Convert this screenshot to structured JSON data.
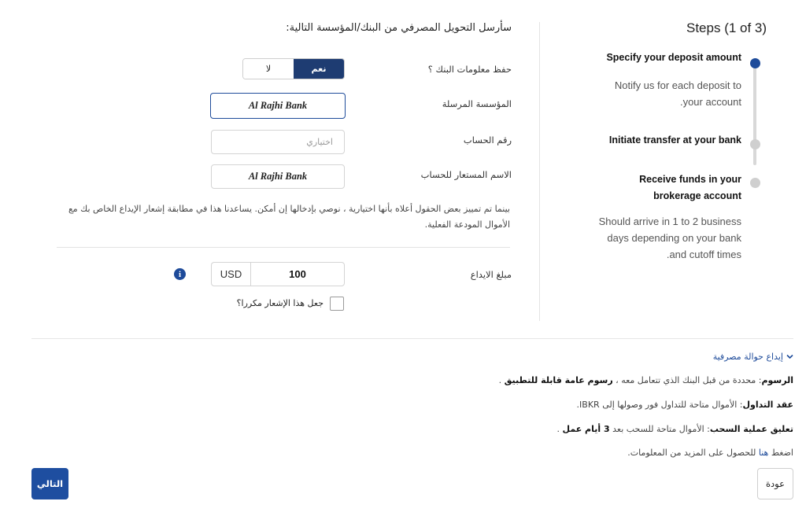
{
  "steps": {
    "title": "Steps (1 of 3)",
    "items": [
      {
        "label": "Specify your deposit amount",
        "desc_1": "Notify us for each deposit to",
        "desc_2": ".your account"
      },
      {
        "label": "Initiate transfer at your bank"
      },
      {
        "label_1": "Receive funds in your",
        "label_2": "brokerage account",
        "desc_1": "Should arrive in 1 to 2 business",
        "desc_2": "days depending on your bank",
        "desc_3": ".and cutoff times"
      }
    ]
  },
  "form": {
    "heading": "سأرسل التحويل المصرفي من البنك/المؤسسة التالية:",
    "save_bank_label": "حفظ معلومات البنك ؟",
    "toggle_yes": "نعم",
    "toggle_no": "لا",
    "institution_label": "المؤسسة المرسلة",
    "institution_value": "Al Rajhi Bank",
    "account_label": "رقم الحساب",
    "account_placeholder": "اختياري",
    "alias_label": "الاسم المستعار للحساب",
    "alias_value": "Al Rajhi Bank",
    "note_1": "بينما تم تمييز بعض الحقول أعلاه بأنها اختيارية ، نوصي بإدخالها إن أمكن. يساعدنا هذا في مطابقة إشعار الإيداع الخاص بك مع",
    "note_2": "الأموال المودعة الفعلية.",
    "amount_label": "مبلغ الايداع",
    "currency": "USD",
    "amount_value": "100",
    "info_icon": "i",
    "recurring_label": "جعل هذا الإشعار مكررا؟"
  },
  "info": {
    "wire_link": "إيداع حوالة مصرفية",
    "fees_bold": "الرسوم",
    "fees_text": ": محددة من قبل البنك الذي تتعامل معه ، ",
    "fees_bold_2": "رسوم عامة قابلة للتطبيق",
    "fees_end": " .",
    "trade_bold": "عقد التداول",
    "trade_text": ": الأموال متاحة للتداول فور وصولها إلى IBKR.",
    "withdraw_bold": "تعليق عملية السحب",
    "withdraw_text": ": الأموال متاحة للسحب بعد ",
    "withdraw_bold_2": "3 أيام عمل",
    "withdraw_end": " .",
    "more_pre": "اضغط ",
    "more_link": "هنا",
    "more_post": " للحصول على المزيد من المعلومات."
  },
  "buttons": {
    "back": "عودة",
    "next": "التالي"
  },
  "colors": {
    "accent": "#1e4b9a",
    "toggle_on": "#1e3c72",
    "next_button": "#1e4ea0"
  }
}
